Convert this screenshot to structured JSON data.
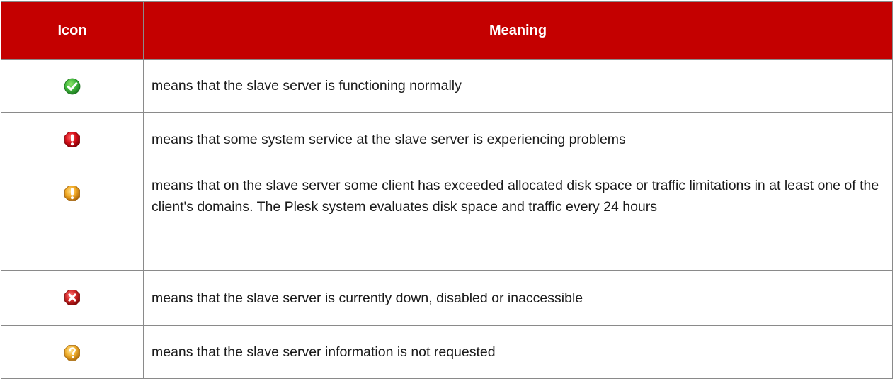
{
  "table": {
    "headers": {
      "icon": "Icon",
      "meaning": "Meaning"
    },
    "rows": [
      {
        "icon": "check-ok-icon",
        "meaning": "means that the slave server is functioning normally"
      },
      {
        "icon": "critical-error-icon",
        "meaning": "means that some system service at the slave server is experiencing problems"
      },
      {
        "icon": "warning-icon",
        "meaning": "means that on the slave server some client has exceeded allocated disk space or traffic limitations in at least one of the client's domains. The Plesk system evaluates disk space and traffic every 24 hours"
      },
      {
        "icon": "down-x-icon",
        "meaning": "means that the slave server is currently down, disabled or inaccessible"
      },
      {
        "icon": "question-icon",
        "meaning": "means that the slave server information is not requested"
      }
    ]
  },
  "colors": {
    "header_bg": "#c40000",
    "header_text": "#ffffff",
    "border": "#8a8a8a",
    "ok_green": "#2fae3a",
    "error_red": "#d8101a",
    "warning_orange": "#e8a020",
    "down_red": "#d22a2a",
    "question_orange": "#f0b030"
  }
}
